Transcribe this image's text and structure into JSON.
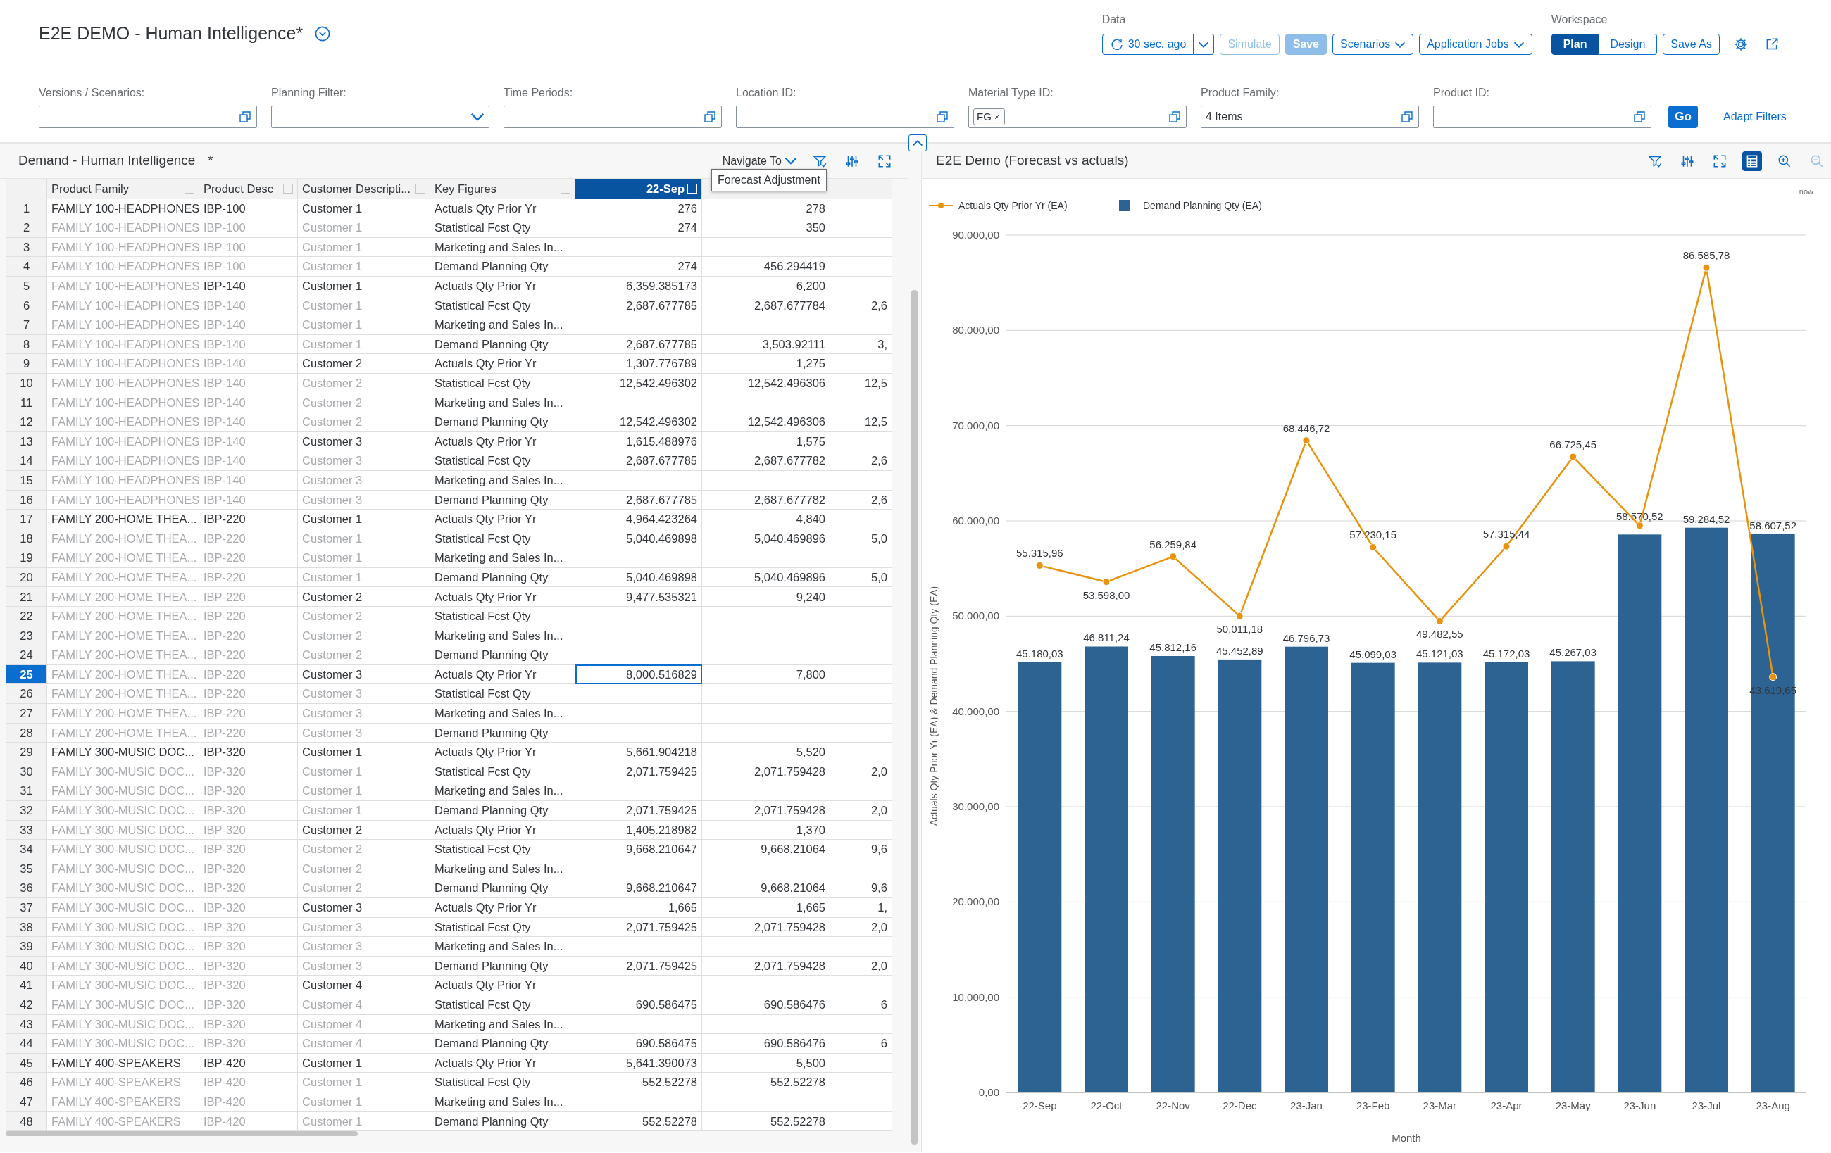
{
  "title": "E2E DEMO - Human Intelligence*",
  "data_group": {
    "label": "Data",
    "refresh": "30 sec. ago",
    "buttons": [
      {
        "label": "Simulate",
        "kind": "plain",
        "disabled": true
      },
      {
        "label": "Save",
        "kind": "emphasized",
        "disabled": true
      },
      {
        "label": "Scenarios",
        "kind": "menu",
        "disabled": false
      },
      {
        "label": "Application Jobs",
        "kind": "menu",
        "disabled": false
      }
    ]
  },
  "workspace": {
    "label": "Workspace",
    "modes": [
      {
        "label": "Plan",
        "selected": true
      },
      {
        "label": "Design",
        "selected": false
      }
    ],
    "save_as": "Save As"
  },
  "filters": [
    {
      "label": "Versions / Scenarios:",
      "kind": "value_help"
    },
    {
      "label": "Planning Filter:",
      "kind": "dropdown"
    },
    {
      "label": "Time Periods:",
      "kind": "value_help"
    },
    {
      "label": "Location ID:",
      "kind": "value_help"
    },
    {
      "label": "Material Type ID:",
      "kind": "value_help",
      "tokens": [
        "FG"
      ]
    },
    {
      "label": "Product Family:",
      "kind": "value_help",
      "value": "4 Items"
    },
    {
      "label": "Product ID:",
      "kind": "value_help"
    }
  ],
  "go_button": "Go",
  "adapt_filters": "Adapt Filters",
  "table_panel": {
    "title": "Demand - Human Intelligence",
    "modified_mark": "*",
    "navigate_to": "Navigate To",
    "tooltip": "Forecast Adjustment",
    "columns": [
      {
        "label": "Product Family",
        "selected": false
      },
      {
        "label": "Product Desc",
        "selected": false
      },
      {
        "label": "Customer Descripti...",
        "selected": false
      },
      {
        "label": "Key Figures",
        "selected": false
      },
      {
        "label": "22-Sep",
        "selected": true
      }
    ],
    "rows": [
      {
        "row_number": "1",
        "product_family": "FAMILY 100-HEADPHONES",
        "product_desc": "IBP-100",
        "customer": "Customer 1",
        "key_figure": "Actuals Qty Prior Yr",
        "sep_22": "276",
        "column_6": "278",
        "dimmed": [
          false,
          false,
          false
        ],
        "selected": false
      },
      {
        "row_number": "2",
        "product_family": "FAMILY 100-HEADPHONES",
        "product_desc": "IBP-100",
        "customer": "Customer 1",
        "key_figure": "Statistical Fcst Qty",
        "sep_22": "274",
        "column_6": "350",
        "dimmed": [
          true,
          true,
          true
        ],
        "selected": false
      },
      {
        "row_number": "3",
        "product_family": "FAMILY 100-HEADPHONES",
        "product_desc": "IBP-100",
        "customer": "Customer 1",
        "key_figure": "Marketing and Sales In...",
        "dimmed": [
          true,
          true,
          true
        ],
        "selected": false
      },
      {
        "row_number": "4",
        "product_family": "FAMILY 100-HEADPHONES",
        "product_desc": "IBP-100",
        "customer": "Customer 1",
        "key_figure": "Demand Planning Qty",
        "sep_22": "274",
        "column_6": "456.294419",
        "dimmed": [
          true,
          true,
          true
        ],
        "selected": false
      },
      {
        "row_number": "5",
        "product_family": "FAMILY 100-HEADPHONES",
        "product_desc": "IBP-140",
        "customer": "Customer 1",
        "key_figure": "Actuals Qty Prior Yr",
        "sep_22": "6,359.385173",
        "column_6": "6,200",
        "dimmed": [
          true,
          false,
          false
        ],
        "selected": false
      },
      {
        "row_number": "6",
        "product_family": "FAMILY 100-HEADPHONES",
        "product_desc": "IBP-140",
        "customer": "Customer 1",
        "key_figure": "Statistical Fcst Qty",
        "sep_22": "2,687.677785",
        "column_6": "2,687.677784",
        "column_7": "2,6",
        "dimmed": [
          true,
          true,
          true
        ],
        "selected": false
      },
      {
        "row_number": "7",
        "product_family": "FAMILY 100-HEADPHONES",
        "product_desc": "IBP-140",
        "customer": "Customer 1",
        "key_figure": "Marketing and Sales In...",
        "dimmed": [
          true,
          true,
          true
        ],
        "selected": false
      },
      {
        "row_number": "8",
        "product_family": "FAMILY 100-HEADPHONES",
        "product_desc": "IBP-140",
        "customer": "Customer 1",
        "key_figure": "Demand Planning Qty",
        "sep_22": "2,687.677785",
        "column_6": "3,503.92111",
        "column_7": "3,",
        "dimmed": [
          true,
          true,
          true
        ],
        "selected": false
      },
      {
        "row_number": "9",
        "product_family": "FAMILY 100-HEADPHONES",
        "product_desc": "IBP-140",
        "customer": "Customer 2",
        "key_figure": "Actuals Qty Prior Yr",
        "sep_22": "1,307.776789",
        "column_6": "1,275",
        "dimmed": [
          true,
          true,
          false
        ],
        "selected": false
      },
      {
        "row_number": "10",
        "product_family": "FAMILY 100-HEADPHONES",
        "product_desc": "IBP-140",
        "customer": "Customer 2",
        "key_figure": "Statistical Fcst Qty",
        "sep_22": "12,542.496302",
        "column_6": "12,542.496306",
        "column_7": "12,5",
        "dimmed": [
          true,
          true,
          true
        ],
        "selected": false
      },
      {
        "row_number": "11",
        "product_family": "FAMILY 100-HEADPHONES",
        "product_desc": "IBP-140",
        "customer": "Customer 2",
        "key_figure": "Marketing and Sales In...",
        "dimmed": [
          true,
          true,
          true
        ],
        "selected": false
      },
      {
        "row_number": "12",
        "product_family": "FAMILY 100-HEADPHONES",
        "product_desc": "IBP-140",
        "customer": "Customer 2",
        "key_figure": "Demand Planning Qty",
        "sep_22": "12,542.496302",
        "column_6": "12,542.496306",
        "column_7": "12,5",
        "dimmed": [
          true,
          true,
          true
        ],
        "selected": false
      },
      {
        "row_number": "13",
        "product_family": "FAMILY 100-HEADPHONES",
        "product_desc": "IBP-140",
        "customer": "Customer 3",
        "key_figure": "Actuals Qty Prior Yr",
        "sep_22": "1,615.488976",
        "column_6": "1,575",
        "dimmed": [
          true,
          true,
          false
        ],
        "selected": false
      },
      {
        "row_number": "14",
        "product_family": "FAMILY 100-HEADPHONES",
        "product_desc": "IBP-140",
        "customer": "Customer 3",
        "key_figure": "Statistical Fcst Qty",
        "sep_22": "2,687.677785",
        "column_6": "2,687.677782",
        "column_7": "2,6",
        "dimmed": [
          true,
          true,
          true
        ],
        "selected": false
      },
      {
        "row_number": "15",
        "product_family": "FAMILY 100-HEADPHONES",
        "product_desc": "IBP-140",
        "customer": "Customer 3",
        "key_figure": "Marketing and Sales In...",
        "dimmed": [
          true,
          true,
          true
        ],
        "selected": false
      },
      {
        "row_number": "16",
        "product_family": "FAMILY 100-HEADPHONES",
        "product_desc": "IBP-140",
        "customer": "Customer 3",
        "key_figure": "Demand Planning Qty",
        "sep_22": "2,687.677785",
        "column_6": "2,687.677782",
        "column_7": "2,6",
        "dimmed": [
          true,
          true,
          true
        ],
        "selected": false
      },
      {
        "row_number": "17",
        "product_family": "FAMILY 200-HOME THEA...",
        "product_desc": "IBP-220",
        "customer": "Customer 1",
        "key_figure": "Actuals Qty Prior Yr",
        "sep_22": "4,964.423264",
        "column_6": "4,840",
        "dimmed": [
          false,
          false,
          false
        ],
        "selected": false
      },
      {
        "row_number": "18",
        "product_family": "FAMILY 200-HOME THEA...",
        "product_desc": "IBP-220",
        "customer": "Customer 1",
        "key_figure": "Statistical Fcst Qty",
        "sep_22": "5,040.469898",
        "column_6": "5,040.469896",
        "column_7": "5,0",
        "dimmed": [
          true,
          true,
          true
        ],
        "selected": false
      },
      {
        "row_number": "19",
        "product_family": "FAMILY 200-HOME THEA...",
        "product_desc": "IBP-220",
        "customer": "Customer 1",
        "key_figure": "Marketing and Sales In...",
        "dimmed": [
          true,
          true,
          true
        ],
        "selected": false
      },
      {
        "row_number": "20",
        "product_family": "FAMILY 200-HOME THEA...",
        "product_desc": "IBP-220",
        "customer": "Customer 1",
        "key_figure": "Demand Planning Qty",
        "sep_22": "5,040.469898",
        "column_6": "5,040.469896",
        "column_7": "5,0",
        "dimmed": [
          true,
          true,
          true
        ],
        "selected": false
      },
      {
        "row_number": "21",
        "product_family": "FAMILY 200-HOME THEA...",
        "product_desc": "IBP-220",
        "customer": "Customer 2",
        "key_figure": "Actuals Qty Prior Yr",
        "sep_22": "9,477.535321",
        "column_6": "9,240",
        "dimmed": [
          true,
          true,
          false
        ],
        "selected": false
      },
      {
        "row_number": "22",
        "product_family": "FAMILY 200-HOME THEA...",
        "product_desc": "IBP-220",
        "customer": "Customer 2",
        "key_figure": "Statistical Fcst Qty",
        "dimmed": [
          true,
          true,
          true
        ],
        "selected": false
      },
      {
        "row_number": "23",
        "product_family": "FAMILY 200-HOME THEA...",
        "product_desc": "IBP-220",
        "customer": "Customer 2",
        "key_figure": "Marketing and Sales In...",
        "dimmed": [
          true,
          true,
          true
        ],
        "selected": false
      },
      {
        "row_number": "24",
        "product_family": "FAMILY 200-HOME THEA...",
        "product_desc": "IBP-220",
        "customer": "Customer 2",
        "key_figure": "Demand Planning Qty",
        "dimmed": [
          true,
          true,
          true
        ],
        "selected": false
      },
      {
        "row_number": "25",
        "product_family": "FAMILY 200-HOME THEA...",
        "product_desc": "IBP-220",
        "customer": "Customer 3",
        "key_figure": "Actuals Qty Prior Yr",
        "sep_22": "8,000.516829",
        "column_6": "7,800",
        "dimmed": [
          true,
          true,
          false
        ],
        "selected": true
      },
      {
        "row_number": "26",
        "product_family": "FAMILY 200-HOME THEA...",
        "product_desc": "IBP-220",
        "customer": "Customer 3",
        "key_figure": "Statistical Fcst Qty",
        "dimmed": [
          true,
          true,
          true
        ],
        "selected": false
      },
      {
        "row_number": "27",
        "product_family": "FAMILY 200-HOME THEA...",
        "product_desc": "IBP-220",
        "customer": "Customer 3",
        "key_figure": "Marketing and Sales In...",
        "dimmed": [
          true,
          true,
          true
        ],
        "selected": false
      },
      {
        "row_number": "28",
        "product_family": "FAMILY 200-HOME THEA...",
        "product_desc": "IBP-220",
        "customer": "Customer 3",
        "key_figure": "Demand Planning Qty",
        "dimmed": [
          true,
          true,
          true
        ],
        "selected": false
      },
      {
        "row_number": "29",
        "product_family": "FAMILY 300-MUSIC DOC...",
        "product_desc": "IBP-320",
        "customer": "Customer 1",
        "key_figure": "Actuals Qty Prior Yr",
        "sep_22": "5,661.904218",
        "column_6": "5,520",
        "dimmed": [
          false,
          false,
          false
        ],
        "selected": false
      },
      {
        "row_number": "30",
        "product_family": "FAMILY 300-MUSIC DOC...",
        "product_desc": "IBP-320",
        "customer": "Customer 1",
        "key_figure": "Statistical Fcst Qty",
        "sep_22": "2,071.759425",
        "column_6": "2,071.759428",
        "column_7": "2,0",
        "dimmed": [
          true,
          true,
          true
        ],
        "selected": false
      },
      {
        "row_number": "31",
        "product_family": "FAMILY 300-MUSIC DOC...",
        "product_desc": "IBP-320",
        "customer": "Customer 1",
        "key_figure": "Marketing and Sales In...",
        "dimmed": [
          true,
          true,
          true
        ],
        "selected": false
      },
      {
        "row_number": "32",
        "product_family": "FAMILY 300-MUSIC DOC...",
        "product_desc": "IBP-320",
        "customer": "Customer 1",
        "key_figure": "Demand Planning Qty",
        "sep_22": "2,071.759425",
        "column_6": "2,071.759428",
        "column_7": "2,0",
        "dimmed": [
          true,
          true,
          true
        ],
        "selected": false
      },
      {
        "row_number": "33",
        "product_family": "FAMILY 300-MUSIC DOC...",
        "product_desc": "IBP-320",
        "customer": "Customer 2",
        "key_figure": "Actuals Qty Prior Yr",
        "sep_22": "1,405.218982",
        "column_6": "1,370",
        "dimmed": [
          true,
          true,
          false
        ],
        "selected": false
      },
      {
        "row_number": "34",
        "product_family": "FAMILY 300-MUSIC DOC...",
        "product_desc": "IBP-320",
        "customer": "Customer 2",
        "key_figure": "Statistical Fcst Qty",
        "sep_22": "9,668.210647",
        "column_6": "9,668.21064",
        "column_7": "9,6",
        "dimmed": [
          true,
          true,
          true
        ],
        "selected": false
      },
      {
        "row_number": "35",
        "product_family": "FAMILY 300-MUSIC DOC...",
        "product_desc": "IBP-320",
        "customer": "Customer 2",
        "key_figure": "Marketing and Sales In...",
        "dimmed": [
          true,
          true,
          true
        ],
        "selected": false
      },
      {
        "row_number": "36",
        "product_family": "FAMILY 300-MUSIC DOC...",
        "product_desc": "IBP-320",
        "customer": "Customer 2",
        "key_figure": "Demand Planning Qty",
        "sep_22": "9,668.210647",
        "column_6": "9,668.21064",
        "column_7": "9,6",
        "dimmed": [
          true,
          true,
          true
        ],
        "selected": false
      },
      {
        "row_number": "37",
        "product_family": "FAMILY 300-MUSIC DOC...",
        "product_desc": "IBP-320",
        "customer": "Customer 3",
        "key_figure": "Actuals Qty Prior Yr",
        "sep_22": "1,665",
        "column_6": "1,665",
        "column_7": "1,",
        "dimmed": [
          true,
          true,
          false
        ],
        "selected": false
      },
      {
        "row_number": "38",
        "product_family": "FAMILY 300-MUSIC DOC...",
        "product_desc": "IBP-320",
        "customer": "Customer 3",
        "key_figure": "Statistical Fcst Qty",
        "sep_22": "2,071.759425",
        "column_6": "2,071.759428",
        "column_7": "2,0",
        "dimmed": [
          true,
          true,
          true
        ],
        "selected": false
      },
      {
        "row_number": "39",
        "product_family": "FAMILY 300-MUSIC DOC...",
        "product_desc": "IBP-320",
        "customer": "Customer 3",
        "key_figure": "Marketing and Sales In...",
        "dimmed": [
          true,
          true,
          true
        ],
        "selected": false
      },
      {
        "row_number": "40",
        "product_family": "FAMILY 300-MUSIC DOC...",
        "product_desc": "IBP-320",
        "customer": "Customer 3",
        "key_figure": "Demand Planning Qty",
        "sep_22": "2,071.759425",
        "column_6": "2,071.759428",
        "column_7": "2,0",
        "dimmed": [
          true,
          true,
          true
        ],
        "selected": false
      },
      {
        "row_number": "41",
        "product_family": "FAMILY 300-MUSIC DOC...",
        "product_desc": "IBP-320",
        "customer": "Customer 4",
        "key_figure": "Actuals Qty Prior Yr",
        "dimmed": [
          true,
          true,
          false
        ],
        "selected": false
      },
      {
        "row_number": "42",
        "product_family": "FAMILY 300-MUSIC DOC...",
        "product_desc": "IBP-320",
        "customer": "Customer 4",
        "key_figure": "Statistical Fcst Qty",
        "sep_22": "690.586475",
        "column_6": "690.586476",
        "column_7": "6",
        "dimmed": [
          true,
          true,
          true
        ],
        "selected": false
      },
      {
        "row_number": "43",
        "product_family": "FAMILY 300-MUSIC DOC...",
        "product_desc": "IBP-320",
        "customer": "Customer 4",
        "key_figure": "Marketing and Sales In...",
        "dimmed": [
          true,
          true,
          true
        ],
        "selected": false
      },
      {
        "row_number": "44",
        "product_family": "FAMILY 300-MUSIC DOC...",
        "product_desc": "IBP-320",
        "customer": "Customer 4",
        "key_figure": "Demand Planning Qty",
        "sep_22": "690.586475",
        "column_6": "690.586476",
        "column_7": "6",
        "dimmed": [
          true,
          true,
          true
        ],
        "selected": false
      },
      {
        "row_number": "45",
        "product_family": "FAMILY 400-SPEAKERS",
        "product_desc": "IBP-420",
        "customer": "Customer 1",
        "key_figure": "Actuals Qty Prior Yr",
        "sep_22": "5,641.390073",
        "column_6": "5,500",
        "dimmed": [
          false,
          false,
          false
        ],
        "selected": false
      },
      {
        "row_number": "46",
        "product_family": "FAMILY 400-SPEAKERS",
        "product_desc": "IBP-420",
        "customer": "Customer 1",
        "key_figure": "Statistical Fcst Qty",
        "sep_22": "552.52278",
        "column_6": "552.52278",
        "dimmed": [
          true,
          true,
          true
        ],
        "selected": false
      },
      {
        "row_number": "47",
        "product_family": "FAMILY 400-SPEAKERS",
        "product_desc": "IBP-420",
        "customer": "Customer 1",
        "key_figure": "Marketing and Sales In...",
        "dimmed": [
          true,
          true,
          true
        ],
        "selected": false
      },
      {
        "row_number": "48",
        "product_family": "FAMILY 400-SPEAKERS",
        "product_desc": "IBP-420",
        "customer": "Customer 1",
        "key_figure": "Demand Planning Qty",
        "sep_22": "552.52278",
        "column_6": "552.52278",
        "dimmed": [
          true,
          true,
          true
        ],
        "selected": false
      }
    ]
  },
  "chart_panel": {
    "title": "E2E Demo (Forecast vs actuals)",
    "timestamp": "now",
    "toolbar": [
      {
        "kind": "filter",
        "selected": false,
        "disabled": false
      },
      {
        "kind": "sliders",
        "selected": false,
        "disabled": false
      },
      {
        "kind": "expand",
        "selected": false,
        "disabled": false
      },
      {
        "kind": "table",
        "selected": true,
        "disabled": false
      },
      {
        "kind": "zoom_in",
        "selected": false,
        "disabled": false
      },
      {
        "kind": "zoom_out",
        "selected": false,
        "disabled": true
      }
    ],
    "chart_data": {
      "type": "bar",
      "xlabel": "Month",
      "ylabel": "Actuals Qty Prior Yr (EA) & Demand Planning Qty (EA)",
      "categories": [
        "22-Sep",
        "22-Oct",
        "22-Nov",
        "22-Dec",
        "23-Jan",
        "23-Feb",
        "23-Mar",
        "23-Apr",
        "23-May",
        "23-Jun",
        "23-Jul",
        "23-Aug"
      ],
      "ylim": [
        0,
        90000
      ],
      "grid": true,
      "legend": true,
      "yticks": [
        {
          "value": 0,
          "label": "0,00"
        },
        {
          "value": 10000,
          "label": "10.000,00"
        },
        {
          "value": 20000,
          "label": "20.000,00"
        },
        {
          "value": 30000,
          "label": "30.000,00"
        },
        {
          "value": 40000,
          "label": "40.000,00"
        },
        {
          "value": 50000,
          "label": "50.000,00"
        },
        {
          "value": 60000,
          "label": "60.000,00"
        },
        {
          "value": 70000,
          "label": "70.000,00"
        },
        {
          "value": 80000,
          "label": "80.000,00"
        },
        {
          "value": 90000,
          "label": "90.000,00"
        }
      ],
      "series": [
        {
          "name": "Actuals Qty Prior Yr (EA)",
          "type": "line",
          "marker": true,
          "color": "#e9930c",
          "values": [
            55315.96,
            53598.0,
            56259.84,
            50011.18,
            68446.72,
            57230.15,
            49482.55,
            57315.44,
            66725.45,
            59500,
            86585.78,
            43619.65
          ],
          "value_labels": [
            "55.315,96",
            "53.598,00",
            "56.259,84",
            "50.011,18",
            "68.446,72",
            "57.230,15",
            "49.482,55",
            "57.315,44",
            "66.725,45",
            null,
            "86.585,78",
            "43.619,65"
          ]
        },
        {
          "name": "Demand Planning Qty (EA)",
          "color": "#2d6393",
          "values": [
            45180.03,
            46811.24,
            45812.16,
            45452.89,
            46796.73,
            45099.03,
            45121.03,
            45172.03,
            45267.03,
            58570.52,
            59284.52,
            58607.52
          ],
          "value_labels": [
            "45.180,03",
            "46.811,24",
            "45.812,16",
            "45.452,89",
            "46.796,73",
            "45.099,03",
            "45.121,03",
            "45.172,03",
            "45.267,03",
            "58.570,52",
            "59.284,52",
            "58.607,52"
          ]
        }
      ]
    }
  }
}
